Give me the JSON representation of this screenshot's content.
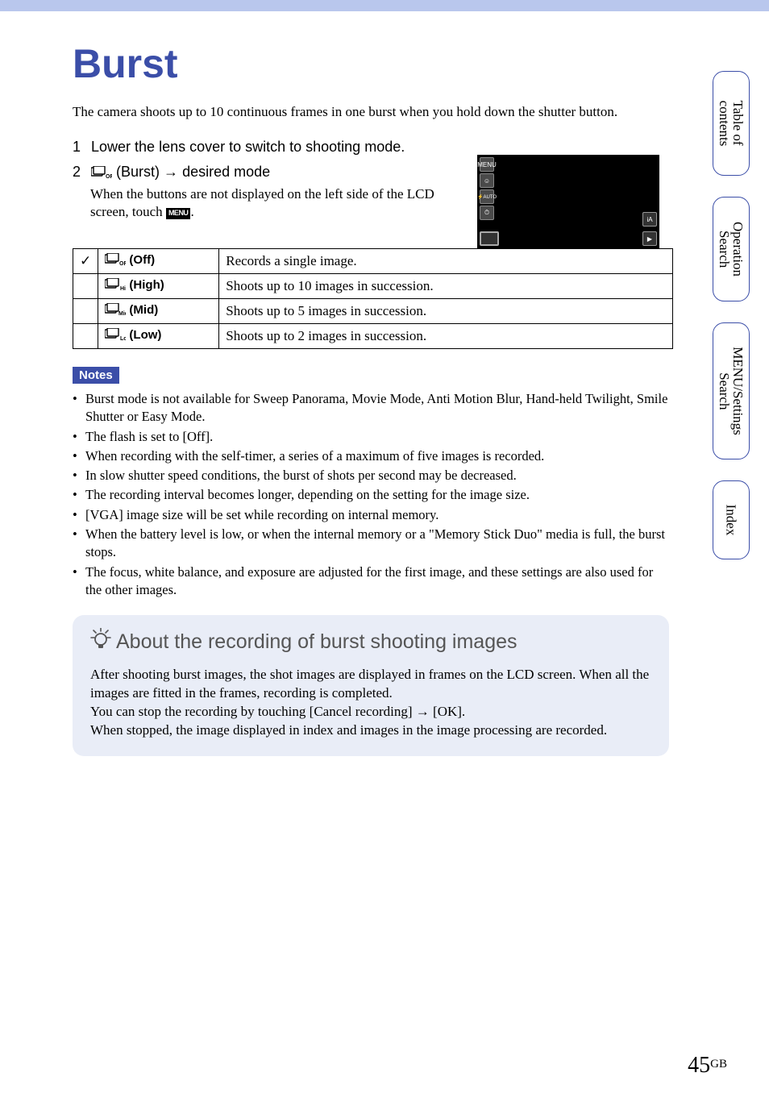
{
  "title": "Burst",
  "intro": "The camera shoots up to 10 continuous frames in one burst when you hold down the shutter button.",
  "steps": [
    {
      "num": "1",
      "text": "Lower the lens cover to switch to shooting mode."
    },
    {
      "num": "2",
      "icon_label": "(Burst)",
      "arrow": "→",
      "text_after": "desired mode",
      "sub": "When the buttons are not displayed on the left side of the LCD screen, touch ",
      "sub_end": "."
    }
  ],
  "menu_label": "MENU",
  "screenshot_mini_icons": [
    "MENU",
    "☺",
    "⚡AUTO",
    "⏱"
  ],
  "modes": [
    {
      "checked": true,
      "label": " (Off)",
      "desc": "Records a single image."
    },
    {
      "checked": false,
      "label": " (High)",
      "desc": "Shoots up to 10 images in succession."
    },
    {
      "checked": false,
      "label": " (Mid)",
      "desc": "Shoots up to 5 images in succession."
    },
    {
      "checked": false,
      "label": " (Low)",
      "desc": "Shoots up to 2 images in succession."
    }
  ],
  "notes_label": "Notes",
  "notes": [
    "Burst mode is not available for Sweep Panorama, Movie Mode, Anti Motion Blur, Hand-held Twilight, Smile Shutter or Easy Mode.",
    "The flash is set to [Off].",
    "When recording with the self-timer, a series of a maximum of five images is recorded.",
    "In slow shutter speed conditions, the burst of shots per second may be decreased.",
    "The recording interval becomes longer, depending on the setting for the image size.",
    "[VGA] image size will be set while recording on internal memory.",
    "When the battery level is low, or when the internal memory or a \"Memory Stick Duo\" media is full, the burst stops.",
    "The focus, white balance, and exposure are adjusted for the first image, and these settings are also used for the other images."
  ],
  "tip": {
    "title": "About the recording of burst shooting images",
    "body": "After shooting burst images, the shot images are displayed in frames on the LCD screen. When all the images are fitted in the frames, recording is completed.\nYou can stop the recording by touching [Cancel recording] → [OK].\nWhen stopped, the image displayed in index and images in the image processing are recorded."
  },
  "side_tabs": [
    "Table of\ncontents",
    "Operation\nSearch",
    "MENU/Settings\nSearch",
    "Index"
  ],
  "page_number": "45",
  "page_suffix": "GB",
  "checkmark": "✓"
}
